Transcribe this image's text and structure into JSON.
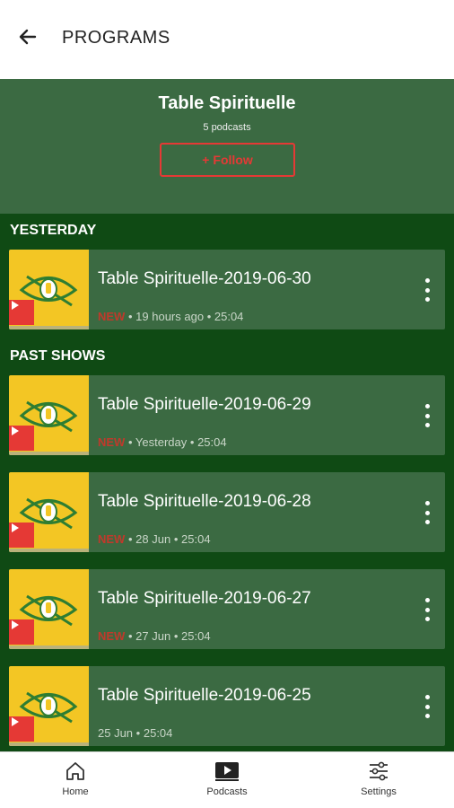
{
  "appbar": {
    "title": "PROGRAMS",
    "back_icon": "arrow-left-icon"
  },
  "hero": {
    "title": "Table Spirituelle",
    "subtitle": "5 podcasts",
    "follow_label": "Follow",
    "follow_prefix": "+"
  },
  "sections": {
    "yesterday": "YESTERDAY",
    "past": "PAST SHOWS"
  },
  "episodes": [
    {
      "title": "Table Spirituelle-2019-06-30",
      "badge": "NEW",
      "sep": "•",
      "age": "19 hours ago",
      "duration": "25:04"
    },
    {
      "title": "Table Spirituelle-2019-06-29",
      "badge": "NEW",
      "sep": "•",
      "age": "Yesterday",
      "duration": "25:04"
    },
    {
      "title": "Table Spirituelle-2019-06-28",
      "badge": "NEW",
      "sep": "•",
      "age": "28 Jun",
      "duration": "25:04"
    },
    {
      "title": "Table Spirituelle-2019-06-27",
      "badge": "NEW",
      "sep": "•",
      "age": "27 Jun",
      "duration": "25:04"
    },
    {
      "title": "Table Spirituelle-2019-06-25",
      "age": "25 Jun",
      "sep": "•",
      "duration": "25:04"
    }
  ],
  "nav": [
    {
      "label": "Home",
      "icon": "home-icon"
    },
    {
      "label": "Podcasts",
      "icon": "podcasts-icon"
    },
    {
      "label": "Settings",
      "icon": "settings-sliders-icon"
    }
  ],
  "colors": {
    "accent": "#e53935",
    "card": "#3b6a42",
    "background": "#0f4a14",
    "thumb": "#f3c624"
  }
}
